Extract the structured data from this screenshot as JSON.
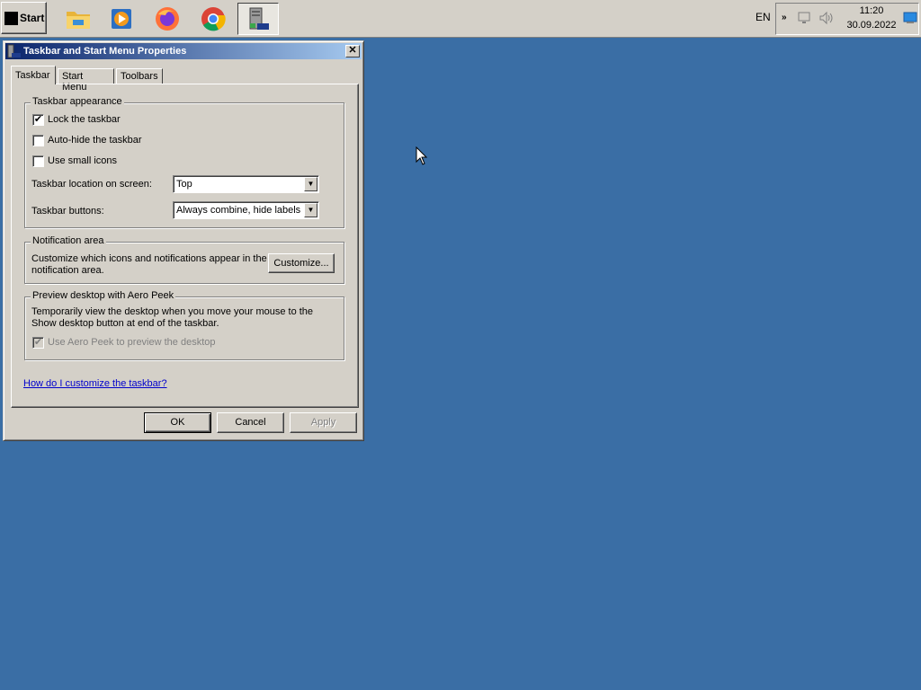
{
  "taskbar": {
    "start_label": "Start",
    "language": "EN",
    "time": "11:20",
    "date": "30.09.2022",
    "apps": [
      {
        "icon": "file-explorer-icon"
      },
      {
        "icon": "media-player-icon"
      },
      {
        "icon": "firefox-icon"
      },
      {
        "icon": "chrome-icon"
      },
      {
        "icon": "taskbar-properties-icon",
        "active": true
      }
    ],
    "tray_icons": [
      "chevron-expand-icon",
      "network-icon",
      "volume-icon",
      "show-desktop-icon"
    ]
  },
  "window": {
    "title": "Taskbar and Start Menu Properties",
    "close_label": "✕",
    "tabs": [
      {
        "label": "Taskbar",
        "selected": true
      },
      {
        "label": "Start Menu"
      },
      {
        "label": "Toolbars"
      }
    ],
    "appearance": {
      "legend": "Taskbar appearance",
      "lock_label": "Lock the taskbar",
      "lock_checked": true,
      "autohide_label": "Auto-hide the taskbar",
      "autohide_checked": false,
      "small_icons_label": "Use small icons",
      "small_icons_checked": false,
      "location_label": "Taskbar location on screen:",
      "location_value": "Top",
      "buttons_label": "Taskbar buttons:",
      "buttons_value": "Always combine, hide labels"
    },
    "notification": {
      "legend": "Notification area",
      "text_line1": "Customize which icons and notifications appear in the",
      "text_line2": "notification area.",
      "customize_label": "Customize..."
    },
    "aero_peek": {
      "legend": "Preview desktop with Aero Peek",
      "text_line1": "Temporarily view the desktop when you move your mouse to the",
      "text_line2": "Show desktop button at end of the taskbar.",
      "checkbox_label": "Use Aero Peek to preview the desktop",
      "checkbox_checked": true
    },
    "help_link": "How do I customize the taskbar?",
    "ok_label": "OK",
    "cancel_label": "Cancel",
    "apply_label": "Apply"
  },
  "colors": {
    "desktop": "#3a6ea5",
    "face": "#d4d0c8",
    "title_start": "#0a246a",
    "title_end": "#a6caf0"
  }
}
